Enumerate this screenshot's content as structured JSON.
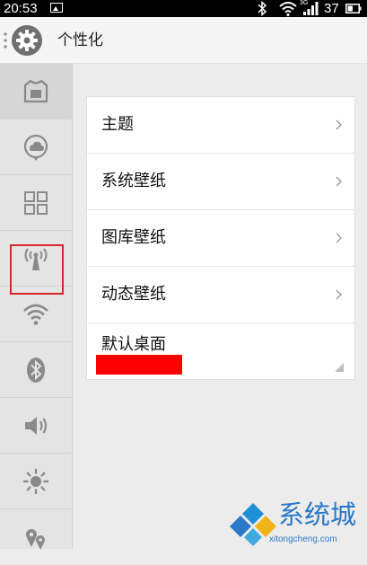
{
  "status_bar": {
    "time": "20:53",
    "network_type": "3G",
    "battery_level": "37"
  },
  "header": {
    "title": "个性化"
  },
  "sidebar": {
    "items": [
      {
        "icon": "theme-shirt-icon",
        "active": true
      },
      {
        "icon": "cloud-sync-icon"
      },
      {
        "icon": "grid-apps-icon",
        "highlighted": true
      },
      {
        "icon": "antenna-signal-icon"
      },
      {
        "icon": "wifi-icon"
      },
      {
        "icon": "bluetooth-icon"
      },
      {
        "icon": "speaker-volume-icon"
      },
      {
        "icon": "brightness-sun-icon"
      },
      {
        "icon": "location-icon"
      }
    ]
  },
  "list": {
    "items": [
      {
        "label": "主题"
      },
      {
        "label": "系统壁纸"
      },
      {
        "label": "图库壁纸"
      },
      {
        "label": "动态壁纸"
      },
      {
        "label": "默认桌面"
      }
    ]
  },
  "watermark": {
    "name": "系统城",
    "url": "xitongcheng.com"
  },
  "colors": {
    "accent_blue": "#2a78c8",
    "highlight_red": "#d9262c",
    "redaction": "#ff0000"
  }
}
